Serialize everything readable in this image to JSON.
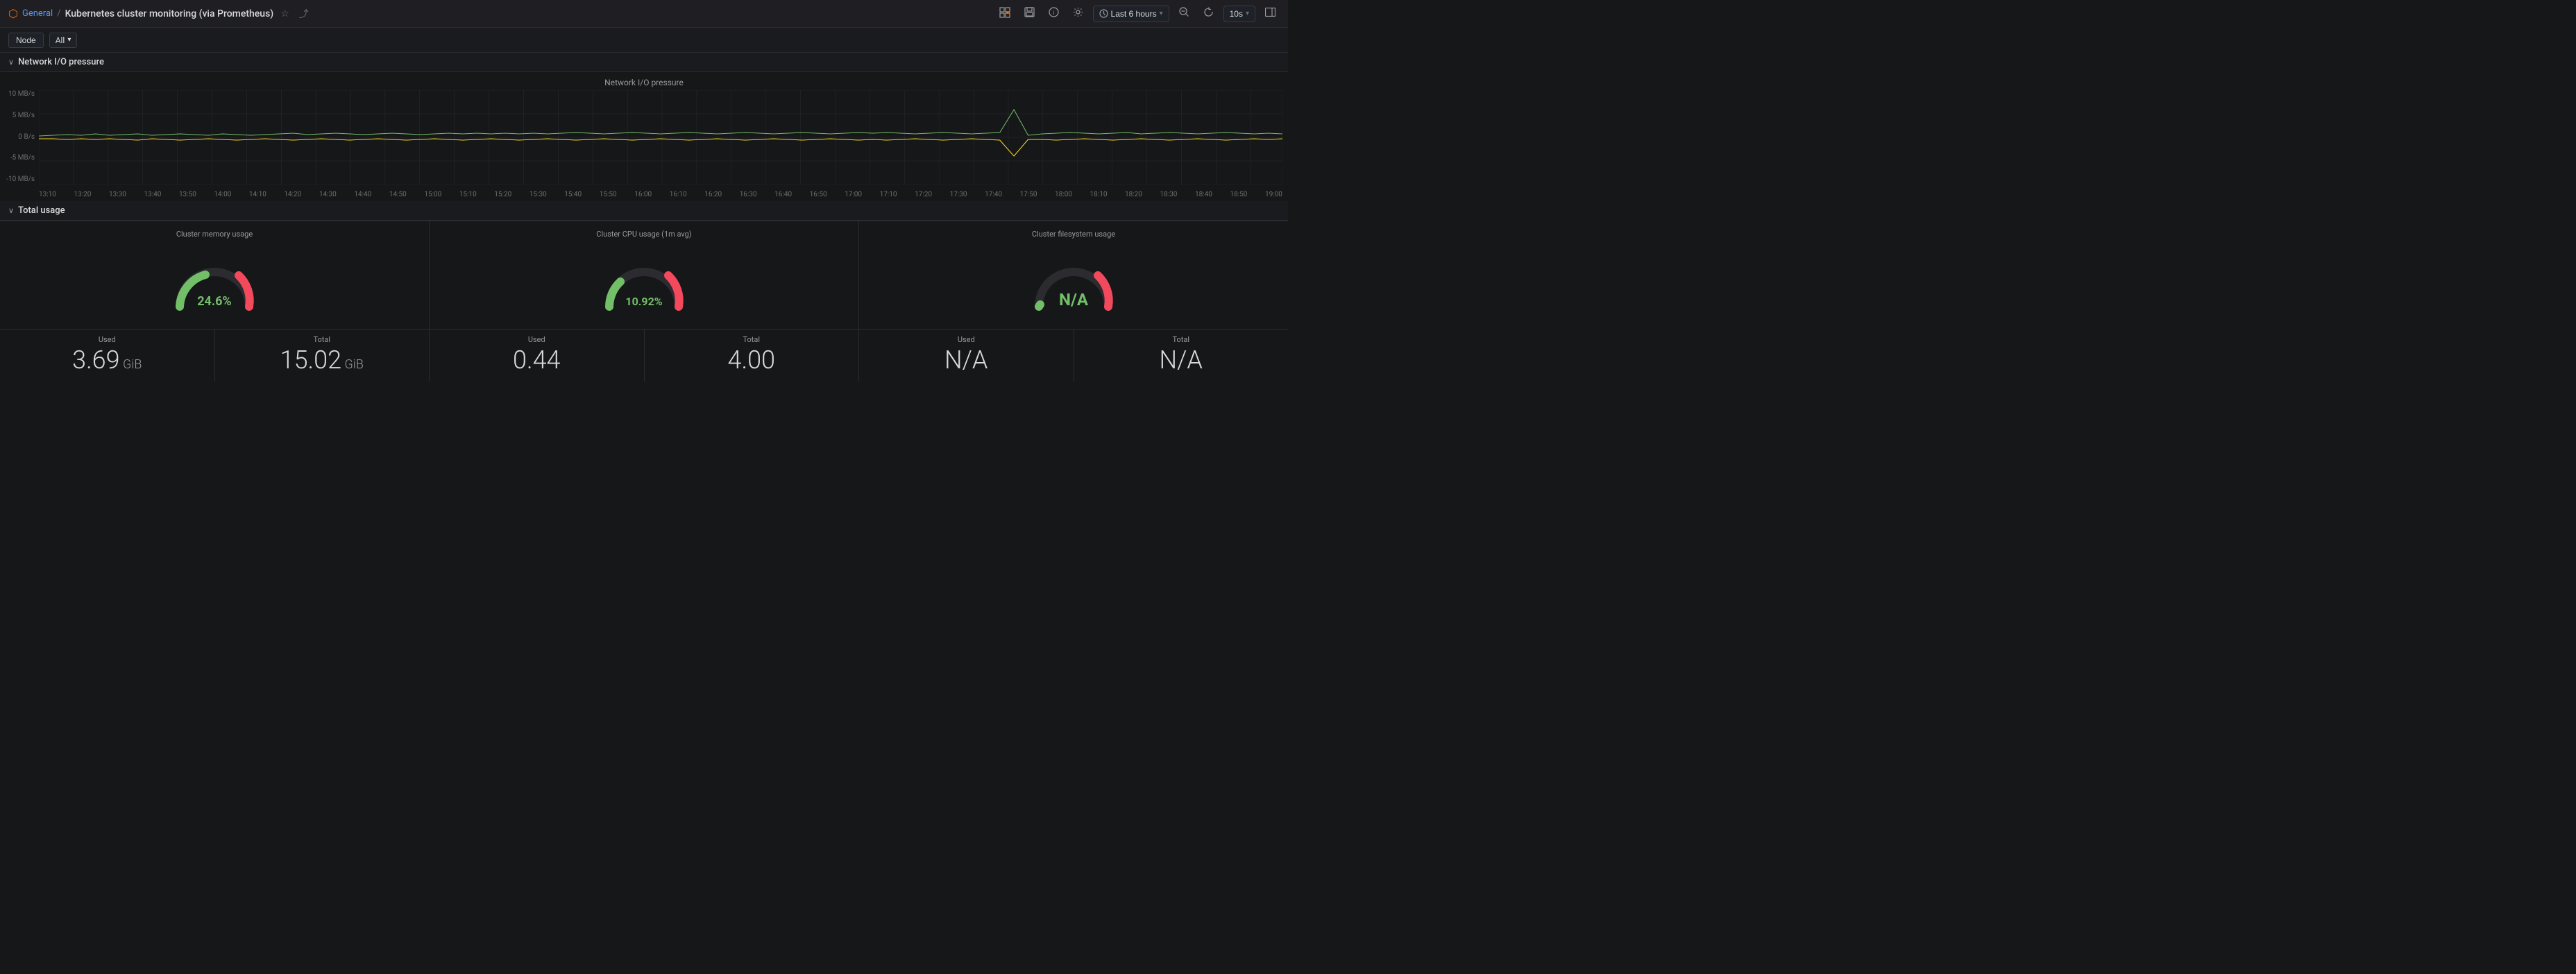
{
  "topbar": {
    "app_icon": "⬡",
    "breadcrumb_home": "General",
    "breadcrumb_sep": "/",
    "dashboard_title": "Kubernetes cluster monitoring (via Prometheus)",
    "star_icon": "☆",
    "share_icon": "⤴",
    "add_panel_icon": "📊",
    "save_icon": "💾",
    "info_icon": "ℹ",
    "settings_icon": "⚙",
    "time_range_icon": "🕐",
    "time_range_label": "Last 6 hours",
    "time_range_chevron": "∨",
    "zoom_out_icon": "🔍",
    "refresh_cycle_icon": "↻",
    "refresh_interval": "10s",
    "refresh_chevron": "∨",
    "sidebar_icon": "☰"
  },
  "filter_bar": {
    "node_label": "Node",
    "all_label": "All",
    "all_chevron": "∨"
  },
  "network_section": {
    "title": "Network I/O pressure",
    "chevron": "∨",
    "chart_title": "Network I/O pressure",
    "y_labels": [
      "10 MB/s",
      "5 MB/s",
      "0 B/s",
      "-5 MB/s",
      "-10 MB/s"
    ],
    "x_labels": [
      "13:10",
      "13:20",
      "13:30",
      "13:40",
      "13:50",
      "14:00",
      "14:10",
      "14:20",
      "14:30",
      "14:40",
      "14:50",
      "15:00",
      "15:10",
      "15:20",
      "15:30",
      "15:40",
      "15:50",
      "16:00",
      "16:10",
      "16:20",
      "16:30",
      "16:40",
      "16:50",
      "17:00",
      "17:10",
      "17:20",
      "17:30",
      "17:40",
      "17:50",
      "18:00",
      "18:10",
      "18:20",
      "18:30",
      "18:40",
      "18:50",
      "19:00"
    ]
  },
  "total_usage_section": {
    "title": "Total usage",
    "chevron": "∨",
    "panels": [
      {
        "title": "Cluster memory usage",
        "gauge_percent": 24.6,
        "gauge_value_display": "24.6%",
        "gauge_color": "#73bf69"
      },
      {
        "title": "Cluster CPU usage (1m avg)",
        "gauge_percent": 10.92,
        "gauge_value_display": "10.92%",
        "gauge_color": "#73bf69"
      },
      {
        "title": "Cluster filesystem usage",
        "gauge_percent": 0,
        "gauge_value_display": "N/A",
        "gauge_color": "#73bf69"
      }
    ],
    "stats": [
      {
        "label": "Used",
        "value": "3.69",
        "unit": " GiB"
      },
      {
        "label": "Total",
        "value": "15.02",
        "unit": " GiB"
      },
      {
        "label": "Used",
        "value": "0.44",
        "unit": ""
      },
      {
        "label": "Total",
        "value": "4.00",
        "unit": ""
      },
      {
        "label": "Used",
        "value": "N/A",
        "unit": ""
      },
      {
        "label": "Total",
        "value": "N/A",
        "unit": ""
      }
    ]
  }
}
